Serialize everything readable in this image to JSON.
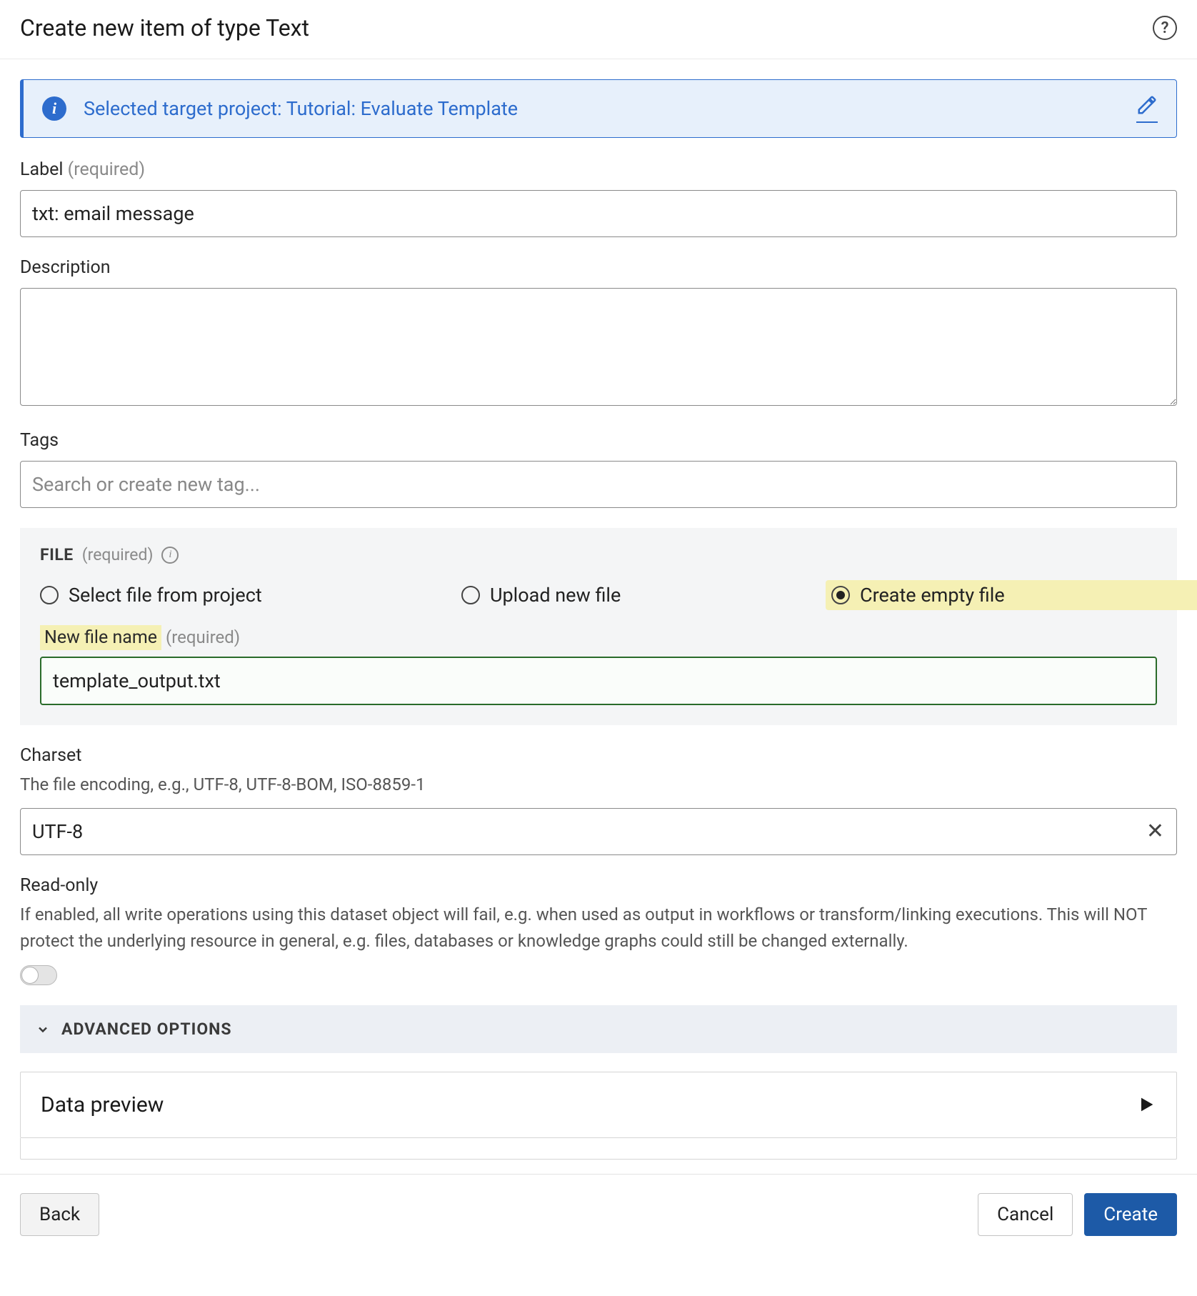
{
  "header": {
    "title": "Create new item of type Text"
  },
  "banner": {
    "text": "Selected target project: Tutorial: Evaluate Template"
  },
  "labels": {
    "label": "Label",
    "required": "(required)",
    "description": "Description",
    "tags": "Tags",
    "tags_placeholder": "Search or create new tag...",
    "file": "FILE",
    "new_file_name": "New file name",
    "charset": "Charset",
    "charset_help": "The file encoding, e.g., UTF-8, UTF-8-BOM, ISO-8859-1",
    "readonly": "Read-only",
    "readonly_help": "If enabled, all write operations using this dataset object will fail, e.g. when used as output in workflows or transform/linking executions. This will NOT protect the underlying resource in general, e.g. files, databases or knowledge graphs could still be changed externally.",
    "advanced": "ADVANCED OPTIONS",
    "preview": "Data preview"
  },
  "values": {
    "label": "txt: email message",
    "description": "",
    "filename": "template_output.txt",
    "charset": "UTF-8"
  },
  "file_options": {
    "select": "Select file from project",
    "upload": "Upload new file",
    "create": "Create empty file"
  },
  "footer": {
    "back": "Back",
    "cancel": "Cancel",
    "create": "Create"
  }
}
